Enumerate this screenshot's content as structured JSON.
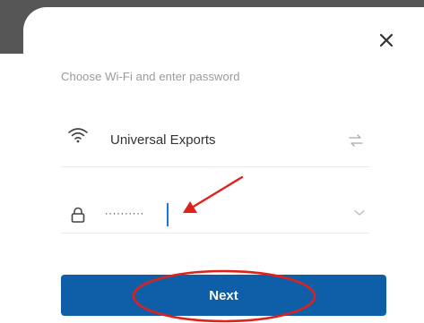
{
  "dialog": {
    "prompt": "Choose Wi-Fi and enter password",
    "close_icon": "close-icon"
  },
  "wifi": {
    "icon": "wifi-icon",
    "ssid": "Universal Exports",
    "switch_icon": "switch-network-icon"
  },
  "password": {
    "icon": "lock-icon",
    "value": "··········",
    "toggle_icon": "chevron-down-icon"
  },
  "next_button": {
    "label": "Next",
    "color": "#0f5fa8"
  },
  "annotations": {
    "arrow_color": "#e0201b",
    "ellipse_color": "#e0201b"
  }
}
